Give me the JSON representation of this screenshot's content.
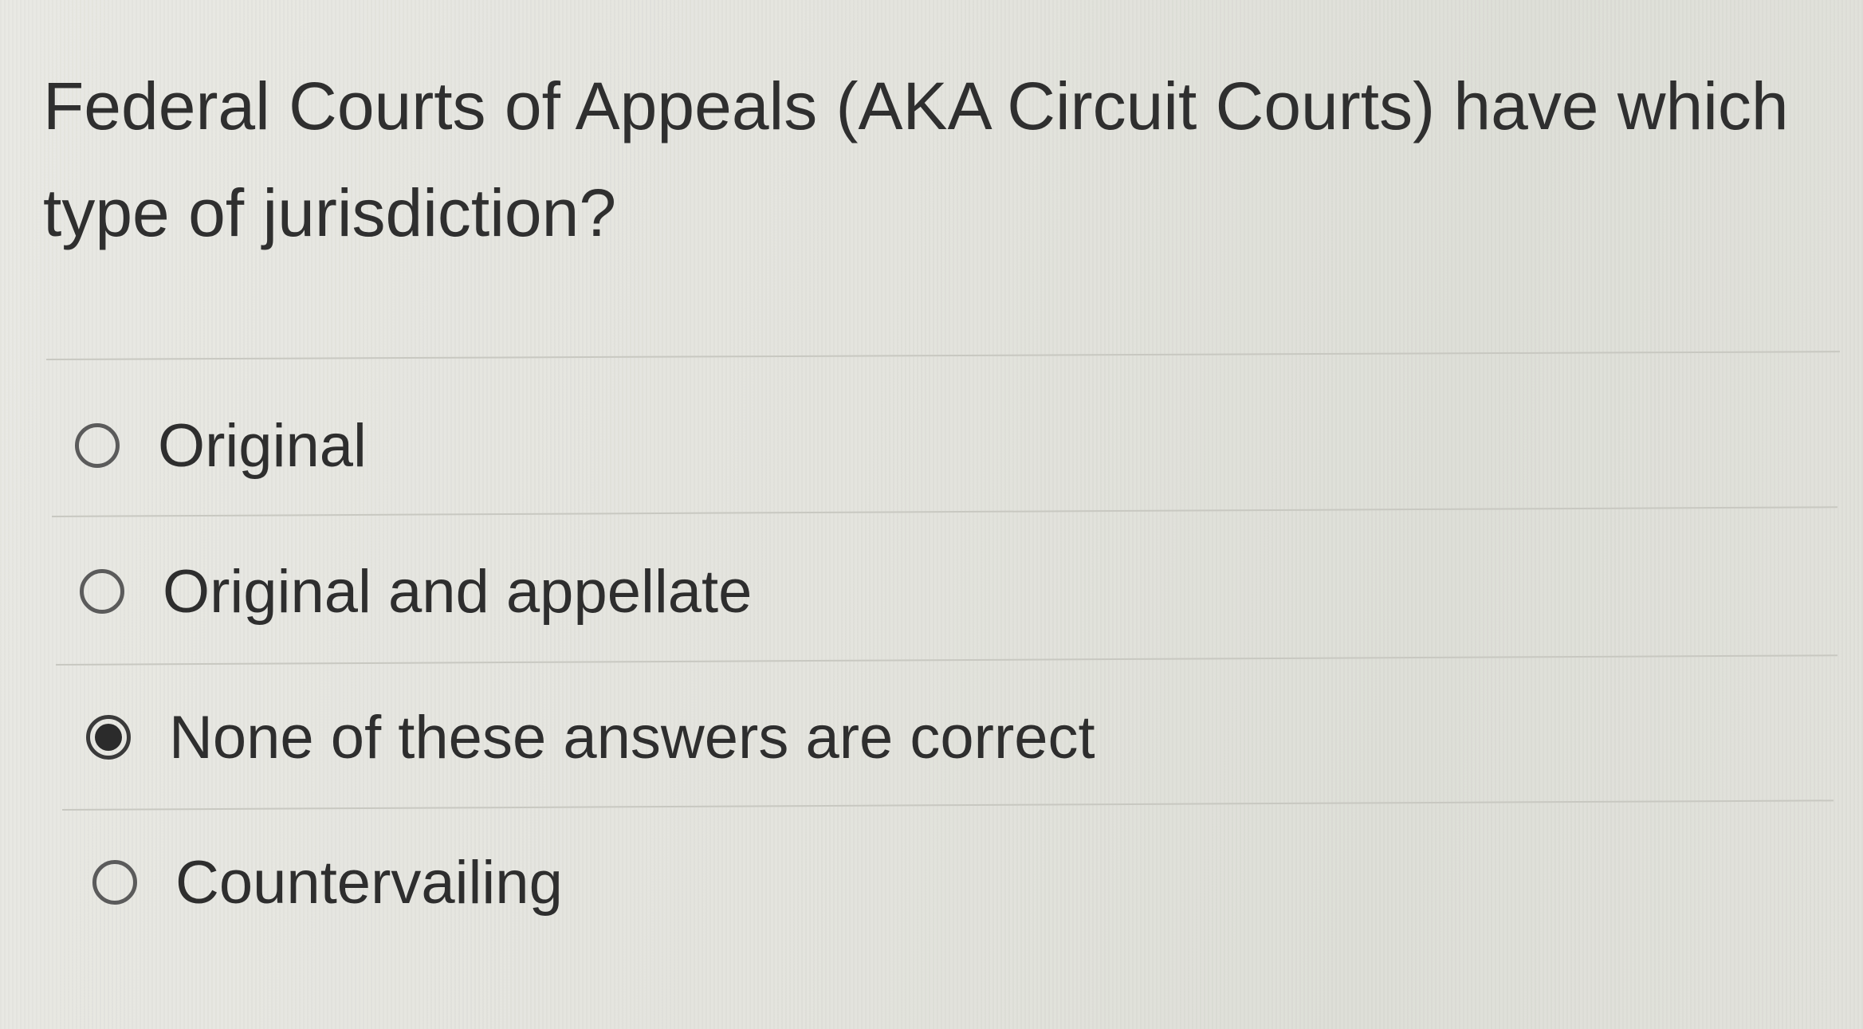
{
  "question": {
    "text": "Federal Courts of Appeals (AKA Circuit Courts) have which type of jurisdiction?"
  },
  "options": [
    {
      "label": "Original",
      "selected": false
    },
    {
      "label": "Original and appellate",
      "selected": false
    },
    {
      "label": "None of these answers are correct",
      "selected": true
    },
    {
      "label": "Countervailing",
      "selected": false
    }
  ]
}
